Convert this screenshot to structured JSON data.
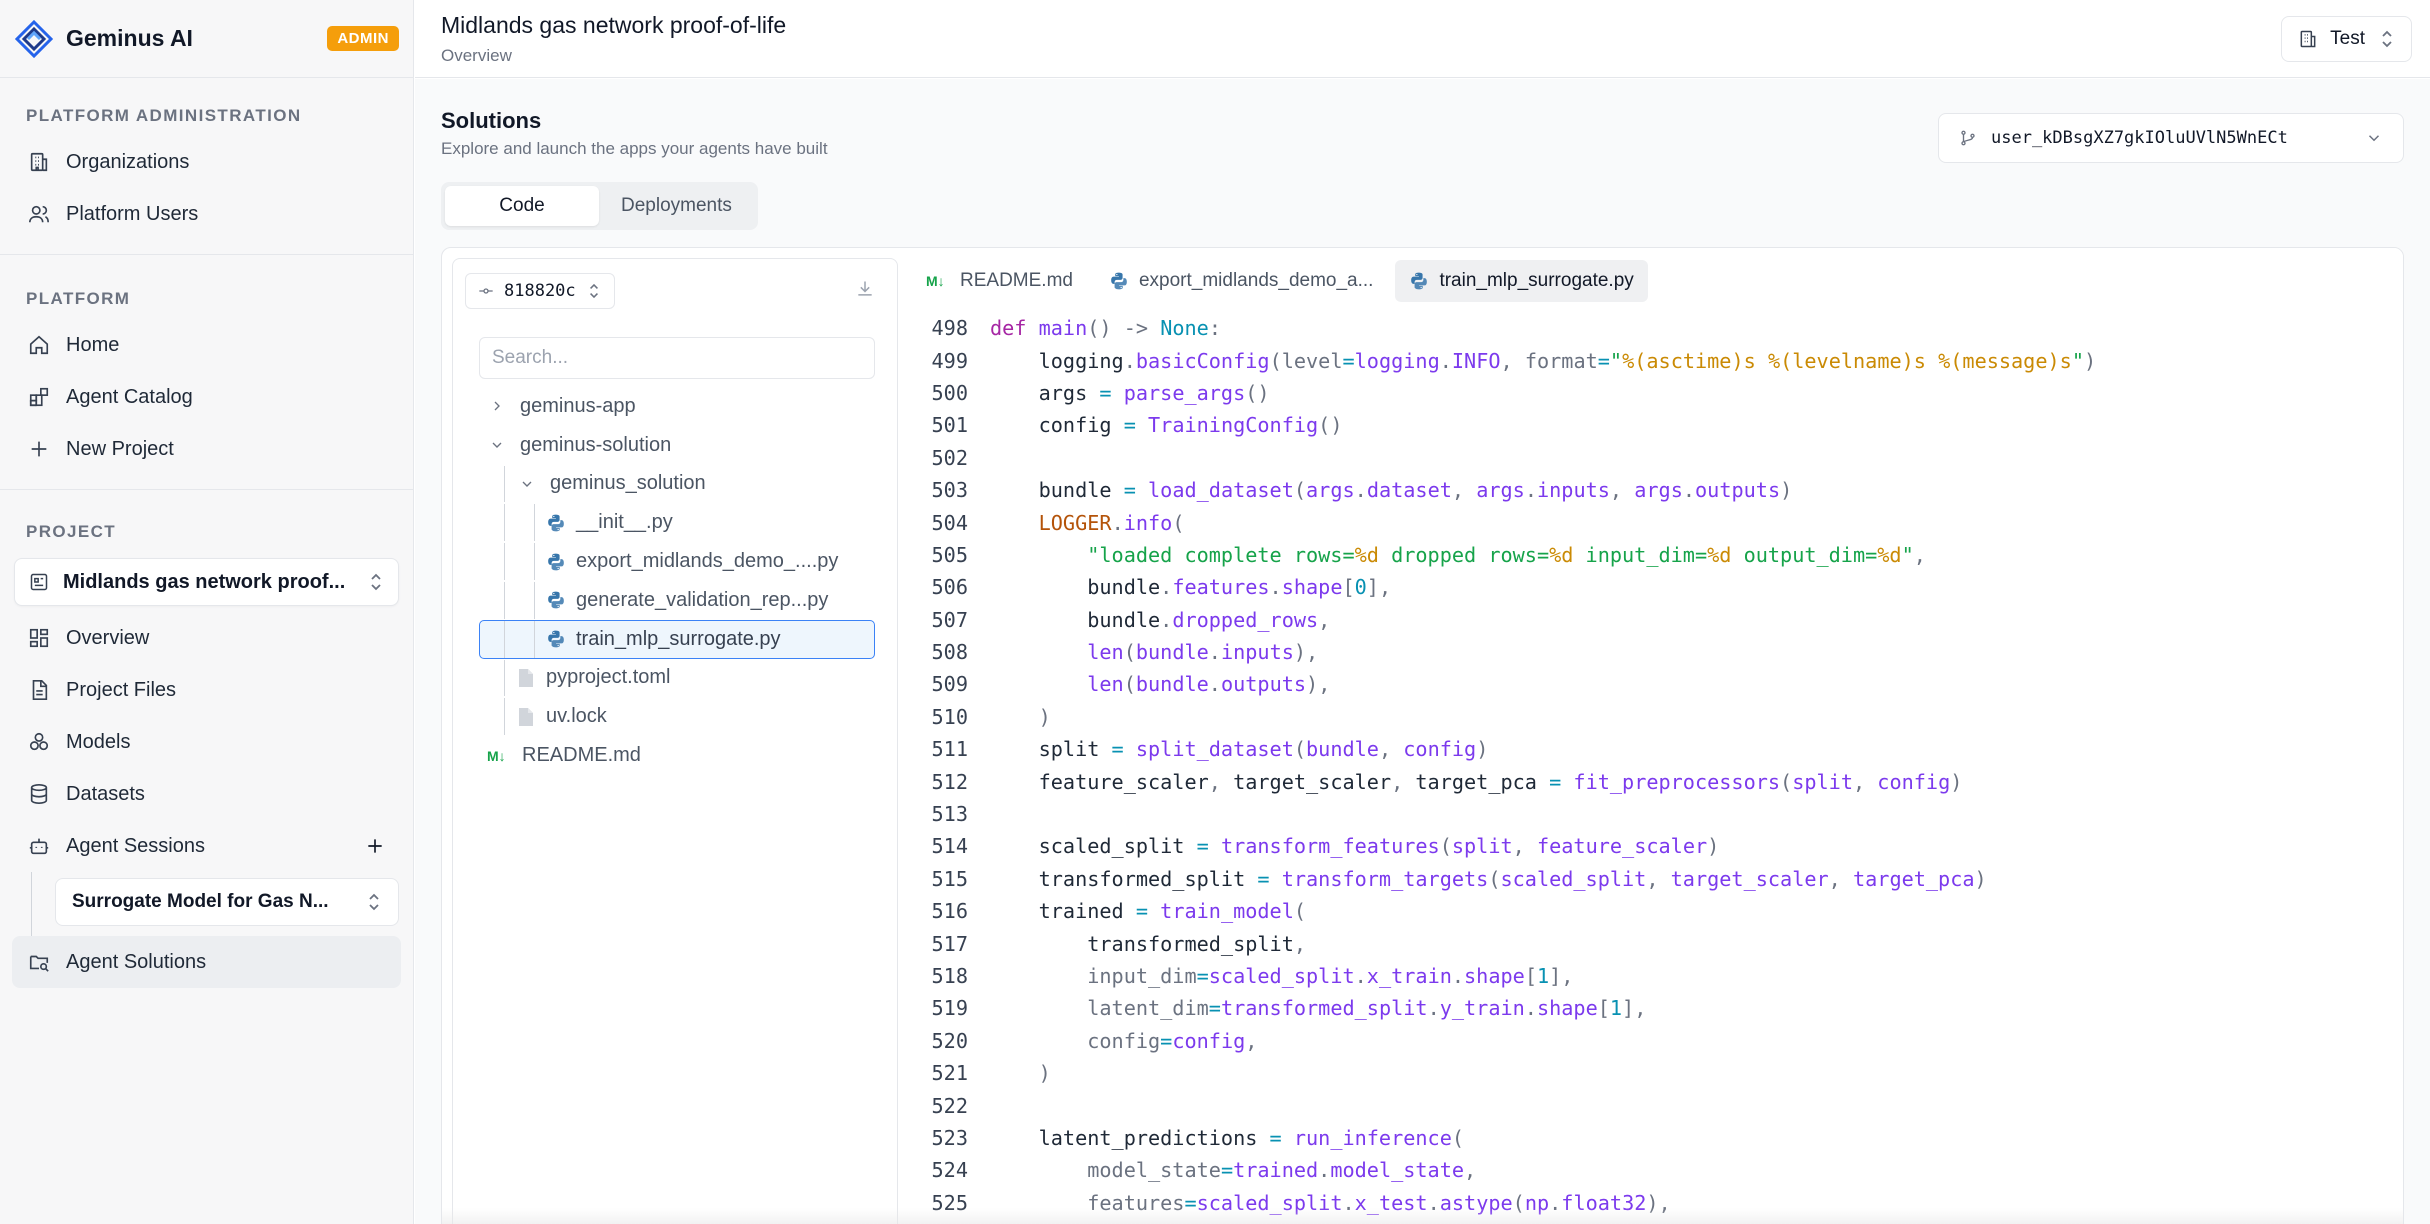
{
  "brand": {
    "name": "Geminus AI",
    "badge": "ADMIN"
  },
  "sidebar": {
    "platform_admin": {
      "heading": "PLATFORM ADMINISTRATION",
      "items": [
        {
          "label": "Organizations",
          "icon": "building-icon"
        },
        {
          "label": "Platform Users",
          "icon": "users-icon"
        }
      ]
    },
    "platform": {
      "heading": "PLATFORM",
      "items": [
        {
          "label": "Home",
          "icon": "home-icon"
        },
        {
          "label": "Agent Catalog",
          "icon": "blocks-icon"
        },
        {
          "label": "New Project",
          "icon": "plus-icon"
        }
      ]
    },
    "project": {
      "heading": "PROJECT",
      "selector": "Midlands gas network proof...",
      "items": [
        {
          "label": "Overview",
          "icon": "dashboard-icon"
        },
        {
          "label": "Project Files",
          "icon": "file-icon"
        },
        {
          "label": "Models",
          "icon": "models-icon"
        },
        {
          "label": "Datasets",
          "icon": "database-icon"
        },
        {
          "label": "Agent Sessions",
          "icon": "bot-icon"
        },
        {
          "label": "Agent Solutions",
          "icon": "folder-search-icon"
        }
      ],
      "session_selector": "Surrogate Model for Gas N..."
    }
  },
  "header": {
    "title": "Midlands gas network proof-of-life",
    "breadcrumb": "Overview",
    "env_button": "Test"
  },
  "main": {
    "title": "Solutions",
    "subtitle": "Explore and launch the apps your agents have built",
    "branch": "user_kDBsgXZ7gkIOluUVlN5WnECt",
    "tabs": [
      "Code",
      "Deployments"
    ],
    "tree": {
      "commit": "818820c",
      "search_placeholder": "Search...",
      "rows": [
        {
          "label": "geminus-app",
          "depth": 0,
          "kind": "folder-closed"
        },
        {
          "label": "geminus-solution",
          "depth": 0,
          "kind": "folder-open"
        },
        {
          "label": "geminus_solution",
          "depth": 1,
          "kind": "folder-open"
        },
        {
          "label": "__init__.py",
          "depth": 2,
          "kind": "python"
        },
        {
          "label": "export_midlands_demo_....py",
          "depth": 2,
          "kind": "python"
        },
        {
          "label": "generate_validation_rep...py",
          "depth": 2,
          "kind": "python"
        },
        {
          "label": "train_mlp_surrogate.py",
          "depth": 2,
          "kind": "python",
          "selected": true
        },
        {
          "label": "pyproject.toml",
          "depth": 1,
          "kind": "file"
        },
        {
          "label": "uv.lock",
          "depth": 1,
          "kind": "file"
        },
        {
          "label": "README.md",
          "depth": 0,
          "kind": "markdown"
        }
      ]
    },
    "editor": {
      "tabs": [
        {
          "label": "README.md",
          "kind": "markdown"
        },
        {
          "label": "export_midlands_demo_a...",
          "kind": "python"
        },
        {
          "label": "train_mlp_surrogate.py",
          "kind": "python",
          "active": true
        }
      ],
      "lines": [
        {
          "n": "498",
          "code": "def main() -> None:"
        },
        {
          "n": "499",
          "code": "    logging.basicConfig(level=logging.INFO, format=\"%(asctime)s %(levelname)s %(message)s\")"
        },
        {
          "n": "500",
          "code": "    args = parse_args()"
        },
        {
          "n": "501",
          "code": "    config = TrainingConfig()"
        },
        {
          "n": "502",
          "code": ""
        },
        {
          "n": "503",
          "code": "    bundle = load_dataset(args.dataset, args.inputs, args.outputs)"
        },
        {
          "n": "504",
          "code": "    LOGGER.info("
        },
        {
          "n": "505",
          "code": "        \"loaded complete rows=%d dropped rows=%d input_dim=%d output_dim=%d\","
        },
        {
          "n": "506",
          "code": "        bundle.features.shape[0],"
        },
        {
          "n": "507",
          "code": "        bundle.dropped_rows,"
        },
        {
          "n": "508",
          "code": "        len(bundle.inputs),"
        },
        {
          "n": "509",
          "code": "        len(bundle.outputs),"
        },
        {
          "n": "510",
          "code": "    )"
        },
        {
          "n": "511",
          "code": "    split = split_dataset(bundle, config)"
        },
        {
          "n": "512",
          "code": "    feature_scaler, target_scaler, target_pca = fit_preprocessors(split, config)"
        },
        {
          "n": "513",
          "code": ""
        },
        {
          "n": "514",
          "code": "    scaled_split = transform_features(split, feature_scaler)"
        },
        {
          "n": "515",
          "code": "    transformed_split = transform_targets(scaled_split, target_scaler, target_pca)"
        },
        {
          "n": "516",
          "code": "    trained = train_model("
        },
        {
          "n": "517",
          "code": "        transformed_split,"
        },
        {
          "n": "518",
          "code": "        input_dim=scaled_split.x_train.shape[1],"
        },
        {
          "n": "519",
          "code": "        latent_dim=transformed_split.y_train.shape[1],"
        },
        {
          "n": "520",
          "code": "        config=config,"
        },
        {
          "n": "521",
          "code": "    )"
        },
        {
          "n": "522",
          "code": ""
        },
        {
          "n": "523",
          "code": "    latent_predictions = run_inference("
        },
        {
          "n": "524",
          "code": "        model_state=trained.model_state,"
        },
        {
          "n": "525",
          "code": "        features=scaled_split.x_test.astype(np.float32),"
        }
      ]
    }
  },
  "colors": {
    "accent_badge": "#f59e0b",
    "selected_border": "#3b82f6",
    "python_blue": "#3776ab",
    "markdown_green": "#16a34a"
  }
}
